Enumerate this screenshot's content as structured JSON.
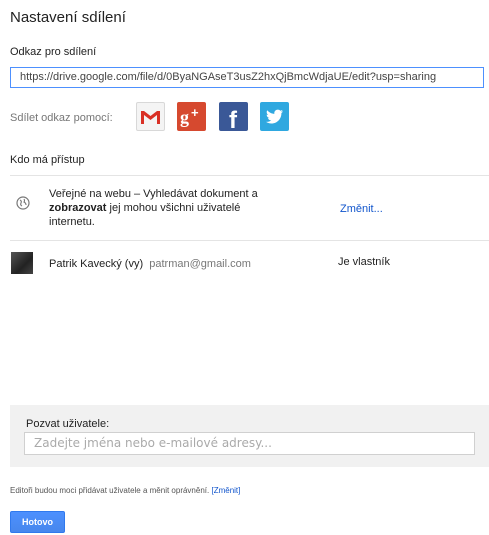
{
  "dialog": {
    "title": "Nastavení sdílení"
  },
  "share_link": {
    "label": "Odkaz pro sdílení",
    "value": "https://drive.google.com/file/d/0ByaNGAseT3usZ2hxQjBmcWdjaUE/edit?usp=sharing"
  },
  "share_via": {
    "label": "Sdílet odkaz pomocí:",
    "icons": [
      "gmail-icon",
      "google-plus-icon",
      "facebook-icon",
      "twitter-icon"
    ]
  },
  "access": {
    "heading": "Kdo má přístup",
    "public": {
      "line1": "Veřejné na webu – Vyhledávat dokument a",
      "bold": "zobrazovat",
      "line2_rest": " jej mohou všichni uživatelé",
      "line3": "internetu.",
      "change_link": "Změnit..."
    },
    "owner": {
      "name": "Patrik Kavecký (vy)",
      "email": "patrman@gmail.com",
      "role": "Je vlastník"
    }
  },
  "invite": {
    "label": "Pozvat uživatele:",
    "placeholder": "Zadejte jména nebo e-mailové adresy..."
  },
  "footer": {
    "note": "Editoři budou moci přidávat uživatele a měnit oprávnění.",
    "change_link": "[Změnit]"
  },
  "done_button": "Hotovo",
  "colors": {
    "accent": "#4d90fe",
    "link": "#1155cc",
    "gplus": "#d6492f",
    "facebook": "#3a5897",
    "twitter": "#2fa8e0"
  }
}
